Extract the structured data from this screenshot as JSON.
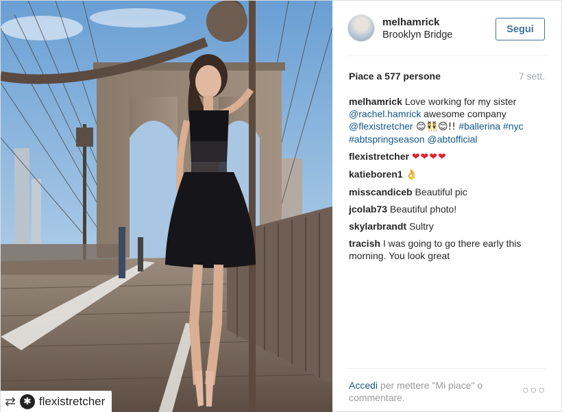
{
  "photo": {
    "alt": "melhamrick Brooklyn Bridge photo",
    "badge": {
      "repost_icon": "repost-icon",
      "logo_icon": "flexistretcher-logo-icon",
      "username": "flexistretcher"
    }
  },
  "header": {
    "username": "melhamrick",
    "location": "Brooklyn Bridge",
    "follow_label": "Segui"
  },
  "stats": {
    "likes": "Piace a 577 persone",
    "time": "7 sett."
  },
  "caption": {
    "user": "melhamrick",
    "text1": "Love working for my sister ",
    "mention1": "@rachel.hamrick",
    "text2": " awesome company ",
    "mention2": "@flexistretcher",
    "emoji": " 😊👯😊!! ",
    "tag1": "#ballerina",
    "tag2": "#nyc",
    "tag3": "#abtspringseason",
    "mention3": "@abtofficial"
  },
  "comments": [
    {
      "user": "flexistretcher",
      "text": "❤❤❤❤"
    },
    {
      "user": "katieboren1",
      "text": "👌"
    },
    {
      "user": "misscandiceb",
      "text": "Beautiful pic"
    },
    {
      "user": "jcolab73",
      "text": "Beautiful photo!"
    },
    {
      "user": "skylarbrandt",
      "text": "Sultry"
    },
    {
      "user": "tracish",
      "text": "I was going to go there early this morning. You look great"
    }
  ],
  "footer": {
    "login_label": "Accedi",
    "prompt": " per mettere \"Mi piace\" o commentare.",
    "more_icon": "more-options-icon",
    "more_glyph": "○○○"
  }
}
